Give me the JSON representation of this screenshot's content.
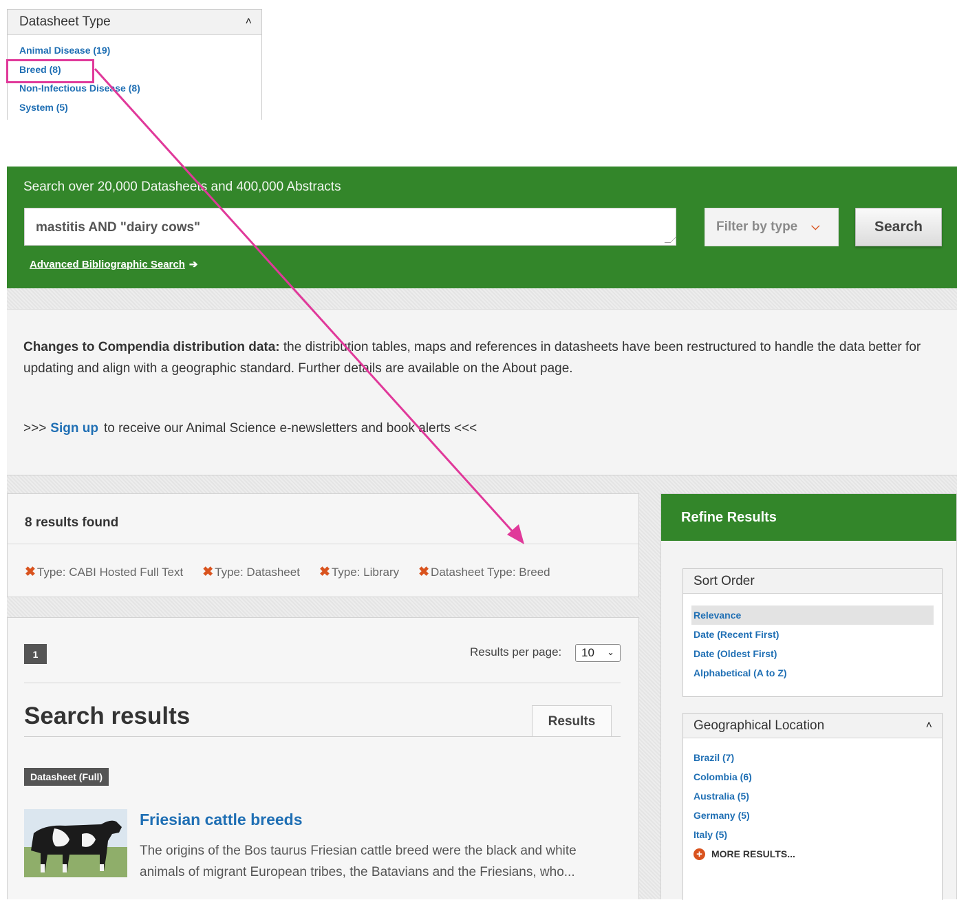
{
  "inset_facet": {
    "title": "Datasheet Type",
    "items": [
      {
        "label": "Animal Disease (19)"
      },
      {
        "label": "Breed (8)"
      },
      {
        "label": "Non-Infectious Disease (8)"
      },
      {
        "label": "System (5)"
      }
    ]
  },
  "annotation": {
    "highlight_color": "#e0399a",
    "arrow_color": "#e0399a"
  },
  "search": {
    "tagline": "Search over 20,000 Datasheets and 400,000 Abstracts",
    "query": "mastitis AND \"dairy cows\"",
    "filter_label": "Filter by type",
    "button_label": "Search",
    "advanced_link": "Advanced Bibliographic Search",
    "band_color": "#33862a"
  },
  "notice": {
    "bold_lead": "Changes to Compendia distribution data:",
    "body": " the distribution tables, maps and references in datasheets have been restructured to handle the data better for updating and align with a geographic standard. Further details are available on the About page.",
    "signup_prefix": ">>>",
    "signup_link": "Sign up",
    "signup_suffix": "to receive our Animal Science e-newsletters and book alerts <<<"
  },
  "results_found": {
    "title": "8 results found",
    "filters": [
      {
        "label": "Type: CABI Hosted Full Text"
      },
      {
        "label": "Type: Datasheet"
      },
      {
        "label": "Type: Library"
      },
      {
        "label": "Datasheet Type: Breed"
      }
    ]
  },
  "results": {
    "current_page": "1",
    "per_page_label": "Results per page:",
    "per_page_value": "10",
    "heading": "Search results",
    "tab_label": "Results",
    "items": [
      {
        "badge": "Datasheet (Full)",
        "title": "Friesian cattle breeds",
        "snippet": "The origins of the Bos taurus Friesian cattle breed were the black and white animals of migrant European tribes, the Batavians and the Friesians, who..."
      }
    ]
  },
  "refine": {
    "title": "Refine Results",
    "sort": {
      "title": "Sort Order",
      "options": [
        {
          "label": "Relevance",
          "selected": true
        },
        {
          "label": "Date (Recent First)"
        },
        {
          "label": "Date (Oldest First)"
        },
        {
          "label": "Alphabetical (A to Z)"
        }
      ]
    },
    "geo": {
      "title": "Geographical Location",
      "items": [
        {
          "label": "Brazil (7)"
        },
        {
          "label": "Colombia (6)"
        },
        {
          "label": "Australia (5)"
        },
        {
          "label": "Germany (5)"
        },
        {
          "label": "Italy (5)"
        }
      ],
      "more_label": "MORE RESULTS..."
    }
  }
}
